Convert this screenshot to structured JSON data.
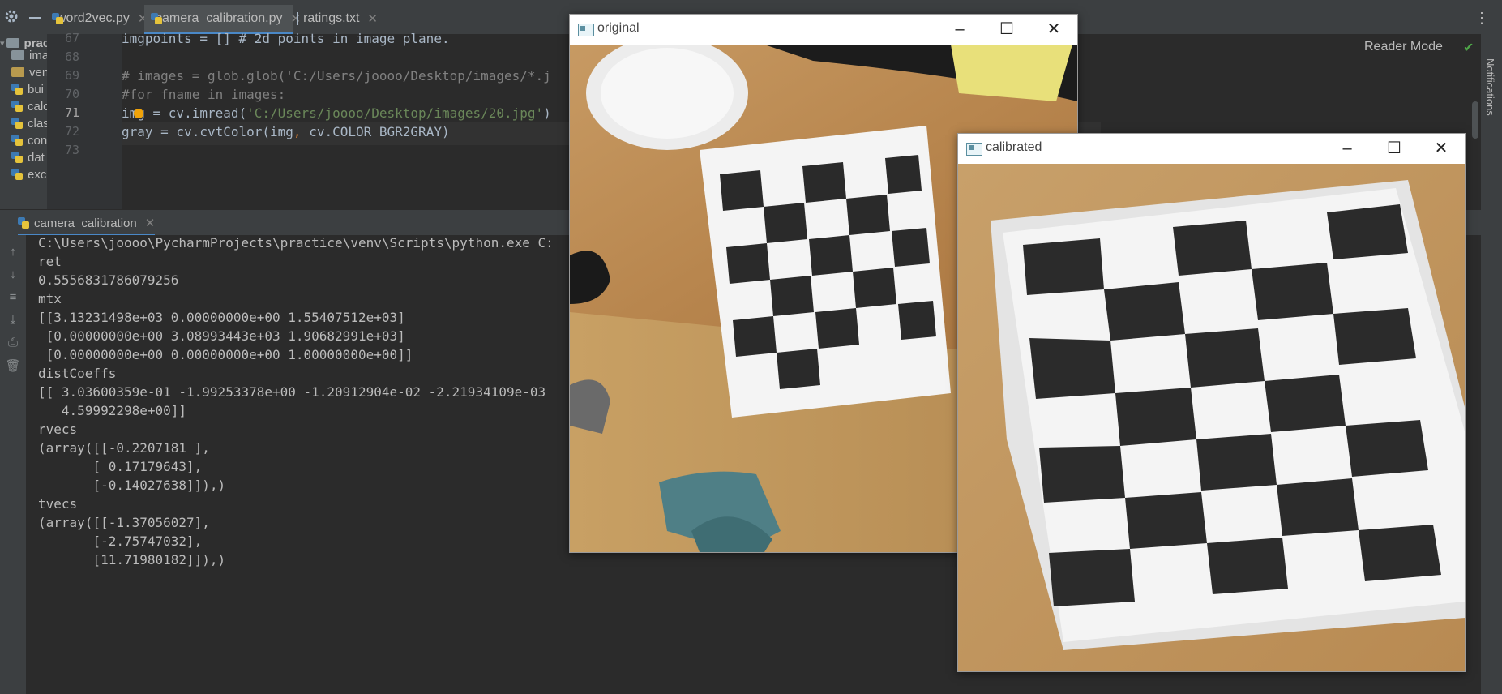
{
  "ide": {
    "tabs": [
      {
        "label": "word2vec.py"
      },
      {
        "label": "camera_calibration.py"
      },
      {
        "label": "ratings.txt"
      }
    ],
    "project": {
      "root": "practic",
      "items": [
        "ima",
        "ven",
        "bui",
        "calc",
        "clas",
        "con",
        "dat",
        "exc"
      ]
    },
    "editor": {
      "line_numbers": [
        "67",
        "68",
        "69",
        "70",
        "71",
        "72",
        "73"
      ],
      "lines": {
        "l67": "imgpoints = [] # 2d points in image plane.",
        "l69": "# images = glob.glob('C:/Users/joooo/Desktop/images/*.j",
        "l70": "#for fname in images:",
        "l71_a": "img = cv.imread(",
        "l71_str": "'C:/Users/joooo/Desktop/images/20.jpg'",
        "l71_b": ")",
        "l72_a": "gray = cv.cvtColor(img",
        "l72_comma": ",",
        "l72_b": " cv.COLOR_BGR2GRAY)"
      },
      "reader_mode": "Reader Mode",
      "notifications": "Notifications"
    },
    "run": {
      "tab": "camera_calibration",
      "console": [
        "C:\\Users\\joooo\\PycharmProjects\\practice\\venv\\Scripts\\python.exe C:",
        "ret",
        "0.5556831786079256",
        "mtx",
        "[[3.13231498e+03 0.00000000e+00 1.55407512e+03]",
        " [0.00000000e+00 3.08993443e+03 1.90682991e+03]",
        " [0.00000000e+00 0.00000000e+00 1.00000000e+00]]",
        "distCoeffs",
        "[[ 3.03600359e-01 -1.99253378e+00 -1.20912904e-02 -2.21934109e-03",
        "   4.59992298e+00]]",
        "rvecs",
        "(array([[-0.2207181 ],",
        "       [ 0.17179643],",
        "       [-0.14027638]]),)",
        "tvecs",
        "(array([[-1.37056027],",
        "       [-2.75747032],",
        "       [11.71980182]]),)"
      ]
    }
  },
  "windows": {
    "original": {
      "title": "original"
    },
    "calibrated": {
      "title": "calibrated"
    }
  }
}
